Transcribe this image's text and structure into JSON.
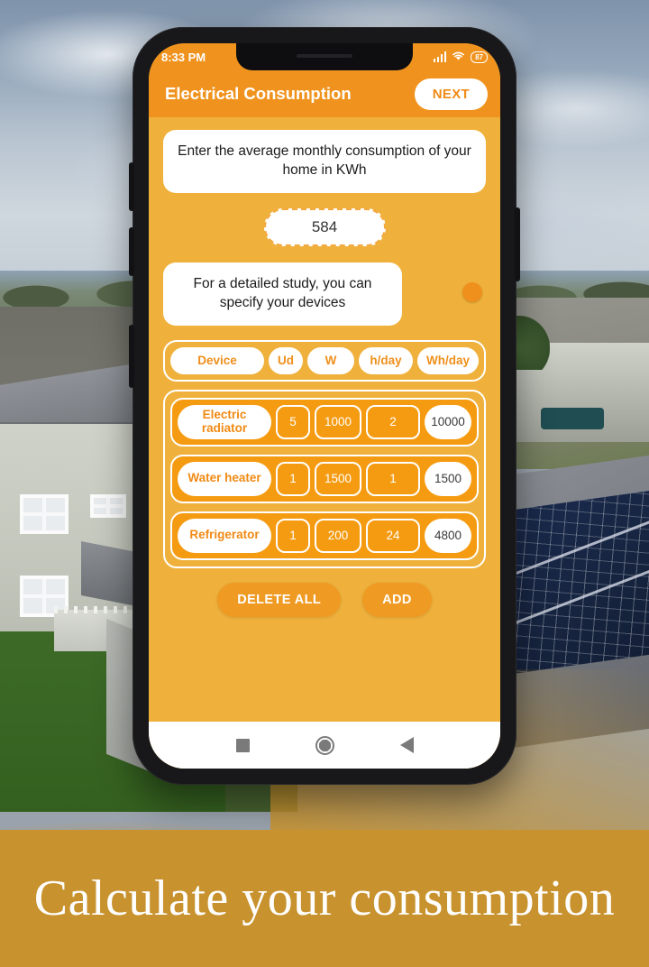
{
  "banner": {
    "headline": "Calculate your consumption"
  },
  "status_bar": {
    "time": "8:33 PM",
    "signal_icon": "signal-bars-icon",
    "wifi_icon": "wifi-icon",
    "battery_level": "87"
  },
  "app": {
    "title": "Electrical Consumption",
    "next_label": "NEXT",
    "prompt": "Enter the average monthly consumption of your home in KWh",
    "kwh_value": "584",
    "kwh_placeholder": "584",
    "detail_note": "For a detailed study, you can specify your devices",
    "table": {
      "headers": [
        "Device",
        "Ud",
        "W",
        "h/day",
        "Wh/day"
      ],
      "rows": [
        {
          "device": "Electric radiator",
          "ud": "5",
          "w": "1000",
          "hday": "2",
          "whday": "10000"
        },
        {
          "device": "Water heater",
          "ud": "1",
          "w": "1500",
          "hday": "1",
          "whday": "1500"
        },
        {
          "device": "Refrigerator",
          "ud": "1",
          "w": "200",
          "hday": "24",
          "whday": "4800"
        }
      ]
    },
    "buttons": {
      "delete_all": "DELETE ALL",
      "add": "ADD"
    }
  },
  "nav_bar": {
    "recents_icon": "square-recents-icon",
    "home_icon": "circle-home-icon",
    "back_icon": "triangle-back-icon"
  },
  "colors": {
    "accent": "#f0931e",
    "page_bg": "#efb13c",
    "row_bg": "#f59b11",
    "banner_bg": "#c8932f"
  }
}
